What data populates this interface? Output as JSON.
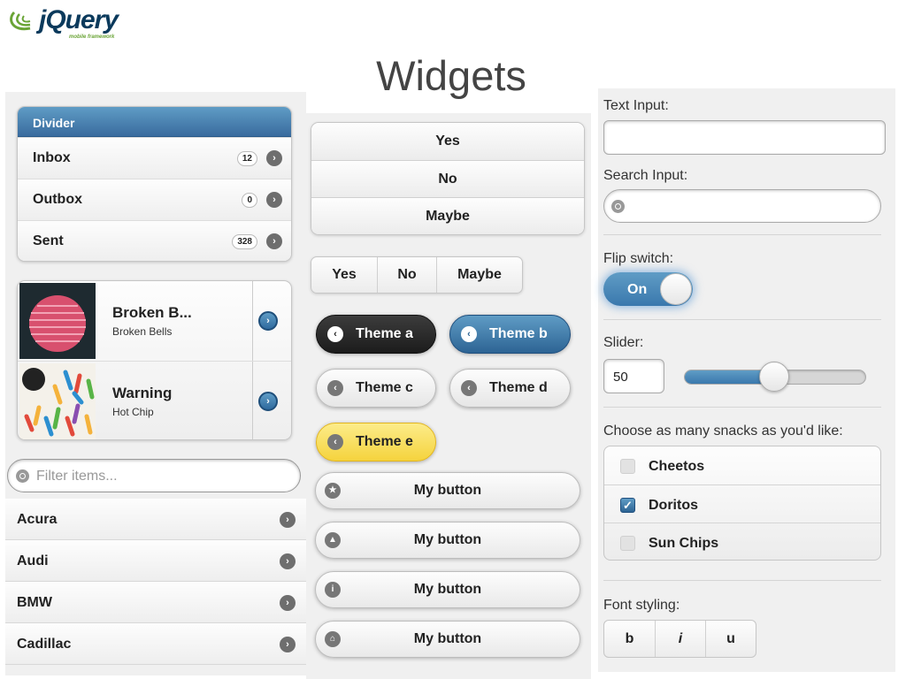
{
  "logo": {
    "word": "jQuery",
    "sub": "mobile framework"
  },
  "page_title": "Widgets",
  "inset_list": {
    "divider": "Divider",
    "items": [
      {
        "label": "Inbox",
        "count": "12"
      },
      {
        "label": "Outbox",
        "count": "0"
      },
      {
        "label": "Sent",
        "count": "328"
      }
    ]
  },
  "thumb_list": [
    {
      "title": "Broken B...",
      "subtitle": "Broken Bells"
    },
    {
      "title": "Warning",
      "subtitle": "Hot Chip"
    }
  ],
  "filter": {
    "placeholder": "Filter items..."
  },
  "car_list": [
    "Acura",
    "Audi",
    "BMW",
    "Cadillac"
  ],
  "vgroup": [
    "Yes",
    "No",
    "Maybe"
  ],
  "hgroup": [
    "Yes",
    "No",
    "Maybe"
  ],
  "theme_buttons": [
    "Theme a",
    "Theme b",
    "Theme c",
    "Theme d",
    "Theme e"
  ],
  "my_buttons": [
    {
      "label": "My button",
      "icon": "star-icon"
    },
    {
      "label": "My button",
      "icon": "alert-icon"
    },
    {
      "label": "My button",
      "icon": "info-icon"
    },
    {
      "label": "My button",
      "icon": "home-icon"
    }
  ],
  "form": {
    "text_input_label": "Text Input:",
    "search_input_label": "Search Input:",
    "flip_label": "Flip switch:",
    "flip_value": "On",
    "slider_label": "Slider:",
    "slider_value": "50",
    "slider_fraction": 0.5,
    "checkbox_label": "Choose as many snacks as you'd like:",
    "checkboxes": [
      {
        "label": "Cheetos",
        "checked": false
      },
      {
        "label": "Doritos",
        "checked": true
      },
      {
        "label": "Sun Chips",
        "checked": false
      }
    ],
    "font_label": "Font styling:",
    "font_buttons": [
      "b",
      "i",
      "u"
    ]
  },
  "colors": {
    "accent": "#3a78ad",
    "theme_e": "#f5d33d"
  }
}
